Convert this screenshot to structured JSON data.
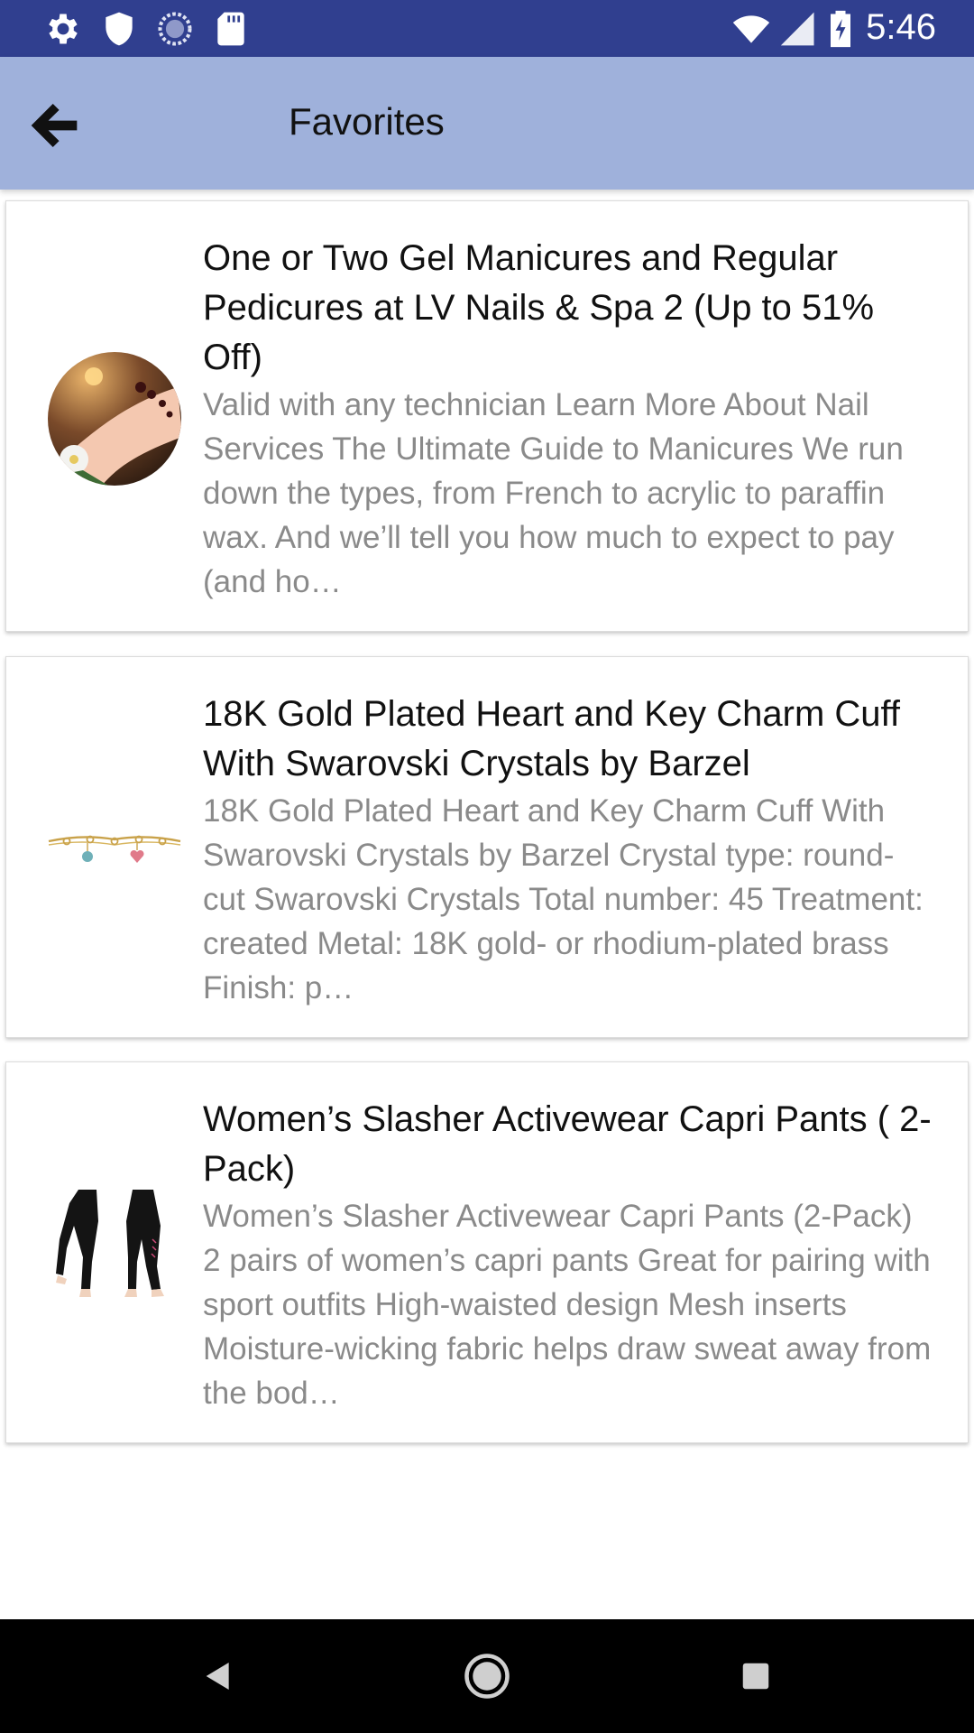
{
  "status_bar": {
    "time": "5:46",
    "left_icons": [
      "gear-icon",
      "shield-icon",
      "sync-icon",
      "sd-card-icon"
    ],
    "right_icons": [
      "wifi-icon",
      "cell-signal-icon",
      "battery-charging-icon"
    ]
  },
  "app_bar": {
    "title": "Favorites",
    "back_icon": "arrow-left-icon",
    "background": "#9FB1DB"
  },
  "colors": {
    "status_bar": "#303F8F",
    "title_text": "#111111",
    "description_text": "#8a8a8a"
  },
  "favorites": [
    {
      "title": "One or Two Gel Manicures and Regular Pedicures at LV Nails & Spa 2 (Up to 51% Off)",
      "description": "Valid with any technician Learn More About Nail Services The Ultimate Guide to Manicures We run down the types, from French to acrylic to paraffin wax. And we’ll tell you how much to expect to pay (and ho…",
      "image": "pedicure-photo"
    },
    {
      "title": "18K Gold Plated Heart and Key Charm Cuff With Swarovski Crystals by Barzel",
      "description": "18K Gold Plated Heart and Key Charm Cuff With Swarovski Crystals by Barzel Crystal type: round-cut Swarovski Crystals Total number: 45 Treatment: created Metal: 18K gold- or rhodium-plated brass Finish: p…",
      "image": "bracelet-photo"
    },
    {
      "title": "Women’s Slasher Activewear Capri Pants ( 2-Pack)",
      "description": "Women’s Slasher Activewear Capri Pants (2-Pack) 2 pairs of women’s capri pants Great for pairing with sport outfits High-waisted design Mesh inserts Moisture-wicking fabric helps draw sweat away from the bod…",
      "image": "capri-pants-photo"
    }
  ],
  "nav_bar": {
    "buttons": [
      "back-triangle-icon",
      "home-circle-icon",
      "recents-square-icon"
    ]
  }
}
